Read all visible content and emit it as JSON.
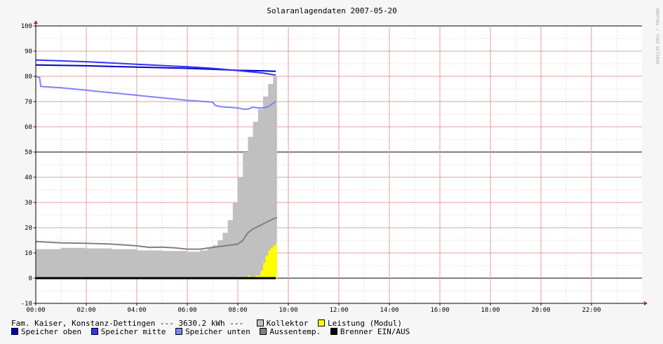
{
  "page": {
    "side_label": "RRDTOOL / TOBI OETIKER"
  },
  "legend": {
    "header": "Fam. Kaiser, Konstanz-Dettingen --- 3630.2 kWh ---",
    "items": [
      {
        "label": "Kollektor",
        "color": "#c0c0c0"
      },
      {
        "label": "Leistung (Modul)",
        "color": "#ffff00"
      },
      {
        "label": "Speicher oben",
        "color": "#0000cc"
      },
      {
        "label": "Speicher mitte",
        "color": "#3333ff"
      },
      {
        "label": "Speicher unten",
        "color": "#8080ff"
      },
      {
        "label": "Aussentemp.",
        "color": "#808080"
      },
      {
        "label": "Brenner EIN/AUS",
        "color": "#000000"
      }
    ]
  },
  "chart_data": {
    "type": "area",
    "title": "Solaranlagendaten 2007-05-20",
    "xlabel": "",
    "ylabel": "",
    "x_ticks": [
      "00:00",
      "02:00",
      "04:00",
      "06:00",
      "08:00",
      "10:00",
      "12:00",
      "14:00",
      "16:00",
      "18:00",
      "20:00",
      "22:00"
    ],
    "y_ticks": [
      "100",
      "90",
      "80",
      "70",
      "60",
      "50",
      "40",
      "30",
      "20",
      "10",
      "0",
      "-10"
    ],
    "xlim": [
      0,
      24
    ],
    "ylim": [
      -10,
      100
    ],
    "grid": true,
    "bold_y_lines": [
      100,
      50,
      0
    ],
    "legend_position": "bottom",
    "series": [
      {
        "name": "Kollektor",
        "style": "area",
        "color": "#c0c0c0",
        "points": [
          [
            0,
            11.5
          ],
          [
            1,
            12
          ],
          [
            2,
            11.8
          ],
          [
            3,
            11.5
          ],
          [
            4,
            11
          ],
          [
            5,
            10.8
          ],
          [
            6,
            10.5
          ],
          [
            6.5,
            11
          ],
          [
            6.8,
            12
          ],
          [
            7,
            13
          ],
          [
            7.2,
            15
          ],
          [
            7.4,
            18
          ],
          [
            7.6,
            23
          ],
          [
            7.8,
            30
          ],
          [
            8.0,
            40
          ],
          [
            8.2,
            50
          ],
          [
            8.4,
            56
          ],
          [
            8.6,
            62
          ],
          [
            8.8,
            67
          ],
          [
            9.0,
            72
          ],
          [
            9.2,
            77
          ],
          [
            9.4,
            80
          ],
          [
            9.55,
            83
          ]
        ]
      },
      {
        "name": "Leistung (Modul)",
        "style": "area",
        "color": "#ffff00",
        "points": [
          [
            8.35,
            0
          ],
          [
            8.4,
            1
          ],
          [
            8.5,
            0
          ],
          [
            8.6,
            0.5
          ],
          [
            8.7,
            1
          ],
          [
            8.9,
            3
          ],
          [
            9.0,
            6
          ],
          [
            9.1,
            9
          ],
          [
            9.2,
            11
          ],
          [
            9.3,
            12
          ],
          [
            9.4,
            13
          ],
          [
            9.5,
            14
          ],
          [
            9.55,
            15
          ]
        ]
      },
      {
        "name": "Speicher oben",
        "style": "line",
        "color": "#0000cc",
        "points": [
          [
            0,
            84.5
          ],
          [
            2,
            84.2
          ],
          [
            4,
            83.7
          ],
          [
            6,
            83.2
          ],
          [
            7,
            82.8
          ],
          [
            8,
            82.4
          ],
          [
            9,
            82.2
          ],
          [
            9.5,
            82
          ]
        ]
      },
      {
        "name": "Speicher mitte",
        "style": "line",
        "color": "#3333ff",
        "points": [
          [
            0,
            86.5
          ],
          [
            2,
            85.8
          ],
          [
            4,
            84.8
          ],
          [
            6,
            83.8
          ],
          [
            7,
            83.2
          ],
          [
            8,
            82.3
          ],
          [
            9,
            81.3
          ],
          [
            9.5,
            80.5
          ]
        ]
      },
      {
        "name": "Speicher unten",
        "style": "line",
        "color": "#8080ff",
        "points": [
          [
            0,
            80
          ],
          [
            0.15,
            79.5
          ],
          [
            0.2,
            76
          ],
          [
            1,
            75.5
          ],
          [
            2,
            74.5
          ],
          [
            3,
            73.5
          ],
          [
            4,
            72.5
          ],
          [
            5,
            71.5
          ],
          [
            6,
            70.5
          ],
          [
            7,
            69.8
          ],
          [
            7.1,
            68.5
          ],
          [
            7.3,
            68
          ],
          [
            8,
            67.5
          ],
          [
            8.2,
            67
          ],
          [
            8.4,
            67
          ],
          [
            8.6,
            67.8
          ],
          [
            8.8,
            67.5
          ],
          [
            9,
            67.5
          ],
          [
            9.2,
            68
          ],
          [
            9.5,
            70
          ]
        ]
      },
      {
        "name": "Aussentemp.",
        "style": "line",
        "color": "#808080",
        "points": [
          [
            0,
            14.5
          ],
          [
            1,
            14
          ],
          [
            2,
            13.8
          ],
          [
            3,
            13.5
          ],
          [
            4,
            12.8
          ],
          [
            4.5,
            12.2
          ],
          [
            5,
            12.3
          ],
          [
            5.5,
            12
          ],
          [
            6,
            11.5
          ],
          [
            6.5,
            11.5
          ],
          [
            7,
            12.2
          ],
          [
            7.5,
            12.8
          ],
          [
            8,
            13.5
          ],
          [
            8.2,
            15
          ],
          [
            8.4,
            18
          ],
          [
            8.6,
            19.5
          ],
          [
            8.8,
            20.5
          ],
          [
            9,
            21.5
          ],
          [
            9.2,
            22.5
          ],
          [
            9.4,
            23.5
          ],
          [
            9.55,
            24
          ]
        ]
      },
      {
        "name": "Brenner EIN/AUS",
        "style": "line",
        "color": "#000000",
        "points": [
          [
            0,
            0
          ],
          [
            9.5,
            0
          ]
        ]
      }
    ]
  }
}
